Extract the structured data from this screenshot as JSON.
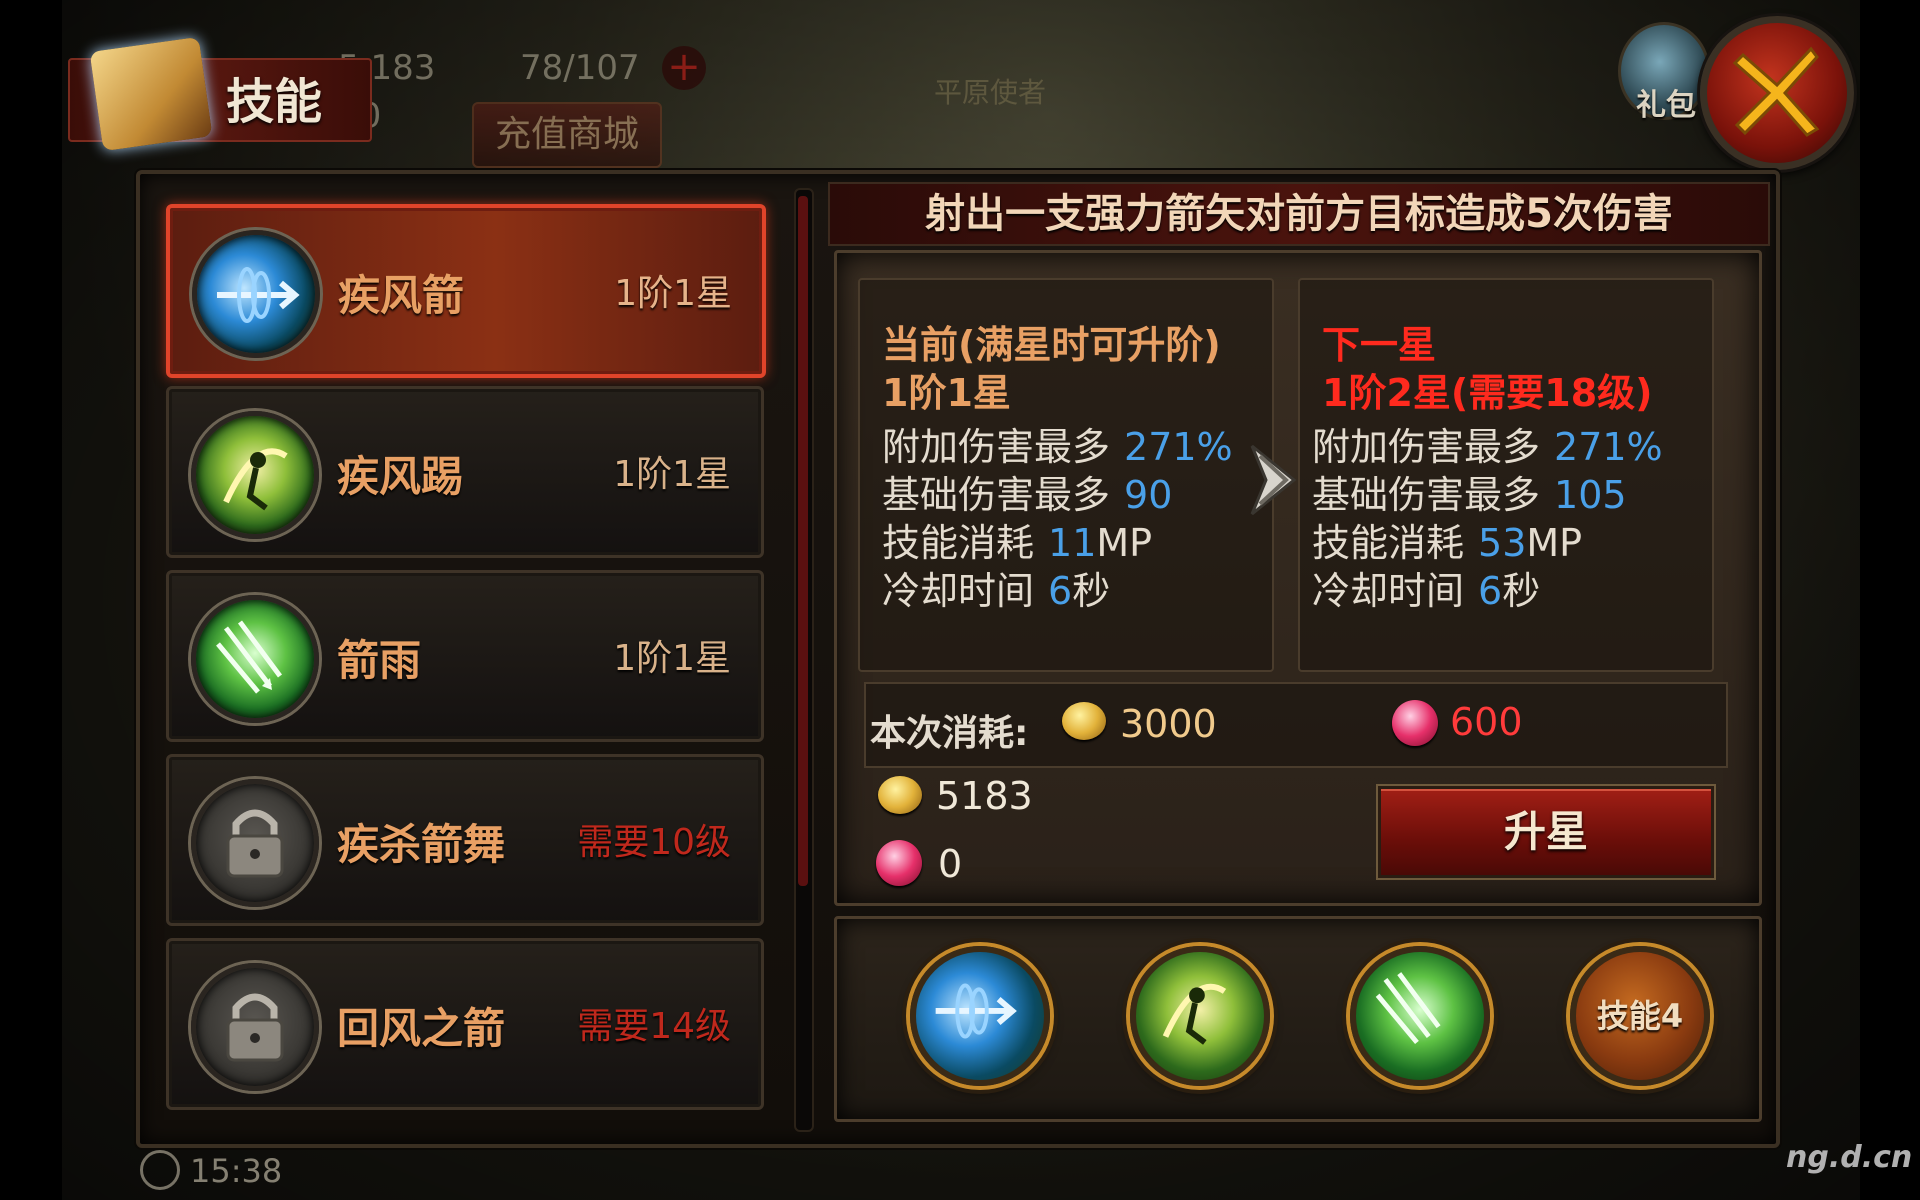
{
  "hud": {
    "gold": "5,183",
    "stamina": "78/107",
    "gems": "10",
    "shop_label": "充值商城",
    "map_name": "平原使者",
    "gift_label": "礼包",
    "time": "15:38"
  },
  "header": {
    "title": "技能"
  },
  "skills": [
    {
      "name": "疾风箭",
      "level": "1阶1星",
      "icon": "wind-arrow-icon",
      "locked": false,
      "active": true
    },
    {
      "name": "疾风踢",
      "level": "1阶1星",
      "icon": "wind-kick-icon",
      "locked": false,
      "active": false
    },
    {
      "name": "箭雨",
      "level": "1阶1星",
      "icon": "arrow-rain-icon",
      "locked": false,
      "active": false
    },
    {
      "name": "疾杀箭舞",
      "level": "需要10级",
      "icon": "lock-icon",
      "locked": true,
      "active": false
    },
    {
      "name": "回风之箭",
      "level": "需要14级",
      "icon": "lock-icon",
      "locked": true,
      "active": false
    }
  ],
  "detail": {
    "description": "射出一支强力箭矢对前方目标造成5次伤害",
    "current": {
      "header": "当前(满星时可升阶)",
      "level": "1阶1星",
      "stats": [
        {
          "label": "附加伤害最多",
          "value": "271%",
          "unit": ""
        },
        {
          "label": "基础伤害最多",
          "value": "90",
          "unit": ""
        },
        {
          "label": "技能消耗",
          "value": "11",
          "unit": "MP"
        },
        {
          "label": "冷却时间",
          "value": "6",
          "unit": "秒"
        }
      ]
    },
    "next": {
      "header": "下一星",
      "level": "1阶2星(需要18级)",
      "stats": [
        {
          "label": "附加伤害最多",
          "value": "271%",
          "unit": ""
        },
        {
          "label": "基础伤害最多",
          "value": "105",
          "unit": ""
        },
        {
          "label": "技能消耗",
          "value": "53",
          "unit": "MP"
        },
        {
          "label": "冷却时间",
          "value": "6",
          "unit": "秒"
        }
      ]
    },
    "cost_label": "本次消耗:",
    "cost_gold": "3000",
    "cost_gems": "600",
    "owned_gold": "5183",
    "owned_gems": "0",
    "upgrade_label": "升星"
  },
  "slots": [
    {
      "icon": "wind-arrow-icon",
      "label": ""
    },
    {
      "icon": "wind-kick-icon",
      "label": ""
    },
    {
      "icon": "arrow-rain-icon",
      "label": ""
    },
    {
      "icon": "empty-slot",
      "label": "技能4"
    }
  ],
  "watermark": "ng.d.cn",
  "colors": {
    "accent_red": "#e0442a",
    "skill_name": "#e8a064",
    "stat_value": "#4aa0e8",
    "requirement": "#c0281c",
    "next_header": "#ff2a1e",
    "current_header": "#e8a064"
  }
}
